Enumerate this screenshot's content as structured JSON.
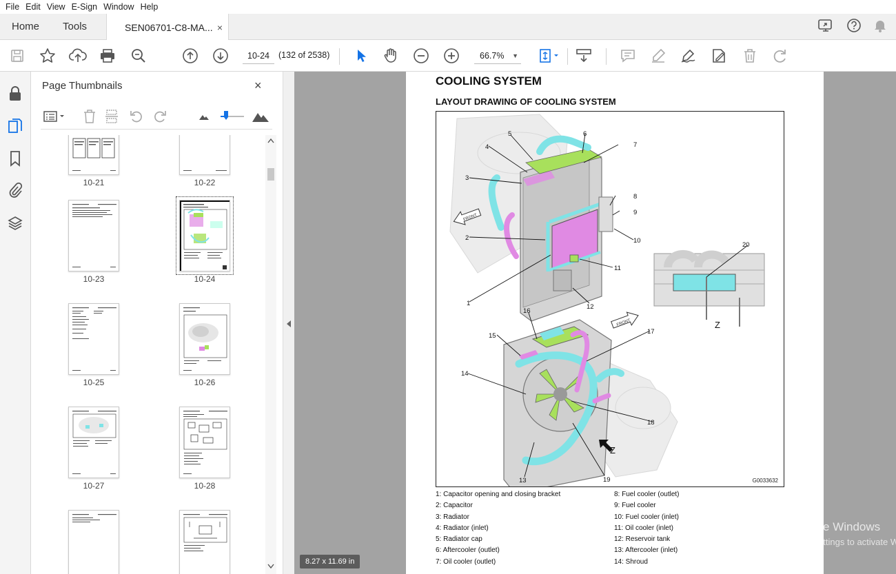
{
  "menu": [
    "File",
    "Edit",
    "View",
    "E-Sign",
    "Window",
    "Help"
  ],
  "tabs": {
    "home": "Home",
    "tools": "Tools",
    "document": "SEN06701-C8-MA...",
    "close": "×"
  },
  "toolbar": {
    "page_value": "10-24",
    "page_count": "(132 of 2538)",
    "zoom_value": "66.7%",
    "zoom_caret": "▼"
  },
  "thumbnails": {
    "title": "Page Thumbnails",
    "close": "×",
    "pages": [
      {
        "label": "10-21",
        "kind": "table"
      },
      {
        "label": "10-22",
        "kind": "blank"
      },
      {
        "label": "10-23",
        "kind": "text"
      },
      {
        "label": "10-24",
        "kind": "figure",
        "selected": true
      },
      {
        "label": "10-25",
        "kind": "text"
      },
      {
        "label": "10-26",
        "kind": "figure"
      },
      {
        "label": "10-27",
        "kind": "figure"
      },
      {
        "label": "10-28",
        "kind": "diagram"
      },
      {
        "label": "",
        "kind": "text"
      },
      {
        "label": "",
        "kind": "diagram"
      }
    ]
  },
  "document": {
    "heading": "COOLING SYSTEM",
    "subheading": "LAYOUT DRAWING OF COOLING SYSTEM",
    "figure_id": "G0033632",
    "callouts": [
      "1",
      "2",
      "3",
      "4",
      "5",
      "6",
      "7",
      "8",
      "9",
      "10",
      "11",
      "12",
      "13",
      "14",
      "15",
      "16",
      "17",
      "18",
      "19",
      "20"
    ],
    "view_label": "Z",
    "front_label": "FRONT",
    "legend_left": [
      "1: Capacitor opening and closing bracket",
      "2: Capacitor",
      "3: Radiator",
      "4: Radiator (inlet)",
      "5: Radiator cap",
      "6: Aftercooler (outlet)",
      "7: Oil cooler (outlet)"
    ],
    "legend_right": [
      "8: Fuel cooler (outlet)",
      "9: Fuel cooler",
      "10: Fuel cooler (inlet)",
      "11: Oil cooler (inlet)",
      "12: Reservoir tank",
      "13: Aftercooler (inlet)",
      "14: Shroud"
    ],
    "page_size": "8.27 x 11.69 in"
  },
  "watermark": {
    "line1": "Activate Windows",
    "line2": "Go to Settings to activate Windows."
  },
  "colors": {
    "cyan": "#7fe3e6",
    "magenta": "#e08ae3",
    "green": "#a8e05c",
    "accent": "#1473e6"
  }
}
